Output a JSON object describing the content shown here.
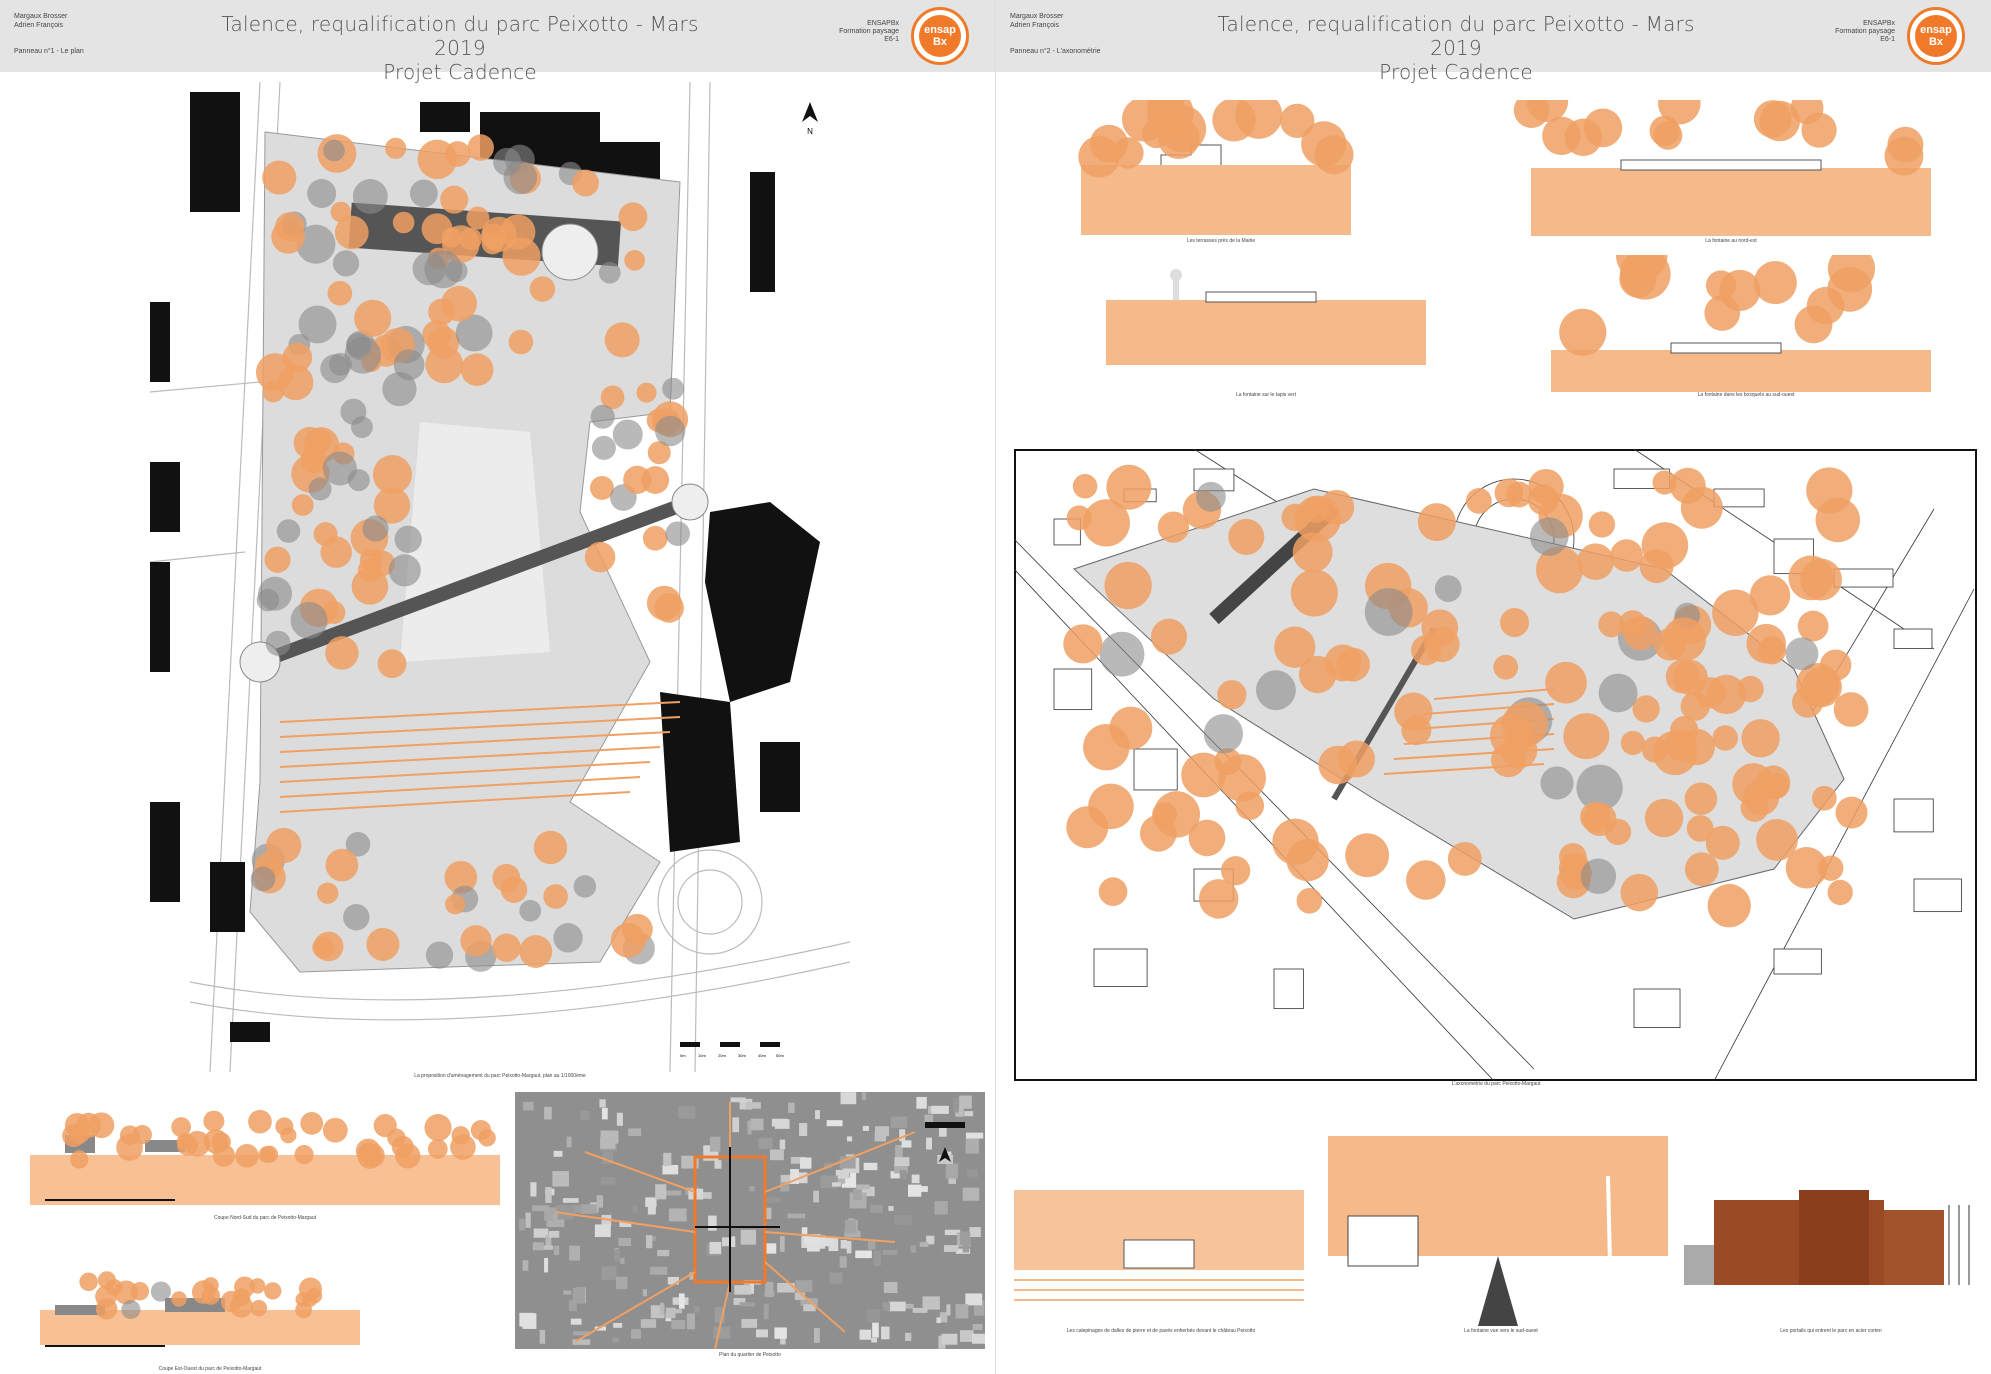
{
  "left_board": {
    "authors": [
      "Margaux Brosser",
      "Adrien François"
    ],
    "panel_label": "Panneau n°1 - Le plan",
    "title_line1": "Talence, requalification du parc Peixotto - Mars 2019",
    "title_line2": "Projet Cadence",
    "school": [
      "ENSAPBx",
      "Formation paysage",
      "E6-1"
    ],
    "logo": [
      "ensap",
      "Bx"
    ],
    "plan_caption": "La proposition d'aménagement du parc Peixotto-Margaut, plan au 1/1000ème",
    "section_ns_caption": "Coupe Nord-Sud du parc de Peixotto-Margaut",
    "section_eo_caption": "Coupe Est-Ouest du parc de Peixotto-Margaut",
    "aerial_caption": "Plan du quartier de Peixotto",
    "scale_labels": [
      "0m",
      "10m",
      "20m",
      "30m",
      "40m",
      "50m"
    ],
    "north": "N"
  },
  "right_board": {
    "authors": [
      "Margaux Brosser",
      "Adrien François"
    ],
    "panel_label": "Panneau n°2 - L'axonométrie",
    "title_line1": "Talence, requalification du parc Peixotto - Mars 2019",
    "title_line2": "Projet Cadence",
    "school": [
      "ENSAPBx",
      "Formation paysage",
      "E6-1"
    ],
    "logo": [
      "ensap",
      "Bx"
    ],
    "section_captions": [
      "Les terrasses près de la Mairie",
      "La fontaine au nord-est",
      "La fontaine sur le tapis vert",
      "La fontaine dans les bosquets au sud-ouest"
    ],
    "axo_caption": "L'axonométrie du parc Peixotto-Margaut",
    "bottom_captions": [
      "Les calepinages de dalles de pierre et de pavés enherbés devant le château Peixotto",
      "La fontaine vue vers le sud-ouest",
      "Les portails qui entrent le parc en acier corten"
    ]
  },
  "colors": {
    "orange": "#f07a2a",
    "tree_orange": "#f0a063",
    "tree_grey": "#8a8a8a",
    "header_bg": "#e4e4e4",
    "building": "#111111",
    "corten": "#9a4a24"
  }
}
